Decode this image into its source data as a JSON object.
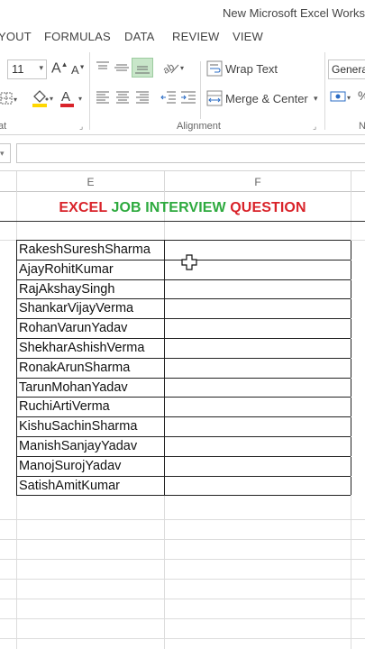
{
  "window": {
    "title": "New Microsoft Excel Works"
  },
  "ribbon_tabs": [
    "YOUT",
    "FORMULAS",
    "DATA",
    "REVIEW",
    "VIEW"
  ],
  "font": {
    "size": "11"
  },
  "alignment": {
    "wrap_text_label": "Wrap Text",
    "merge_center_label": "Merge & Center",
    "group_label": "Alignment"
  },
  "font_group_label_fragment": "at",
  "number": {
    "format": "Genera",
    "group_label_fragment": "N"
  },
  "columns": [
    "E",
    "F"
  ],
  "sheet": {
    "heading": {
      "part1": "EXCEL ",
      "part2": "JOB ",
      "part3": "INTERVIEW ",
      "part4": "QUESTION"
    },
    "names": [
      "RakeshSureshSharma",
      "AjayRohitKumar",
      "RajAkshaySingh",
      "ShankarVijayVerma",
      "RohanVarunYadav",
      "ShekharAshishVerma",
      "RonakArunSharma",
      "TarunMohanYadav",
      "RuchiArtiVerma",
      "KishuSachinSharma",
      "ManishSanjayYadav",
      "ManojSurojYadav",
      "SatishAmitKumar"
    ]
  },
  "colors": {
    "heading_red": "#d9232a",
    "heading_green": "#2eaa3f",
    "fill_yellow": "#ffd700",
    "font_red": "#d9232a",
    "align_active": "#c8e6c9"
  }
}
